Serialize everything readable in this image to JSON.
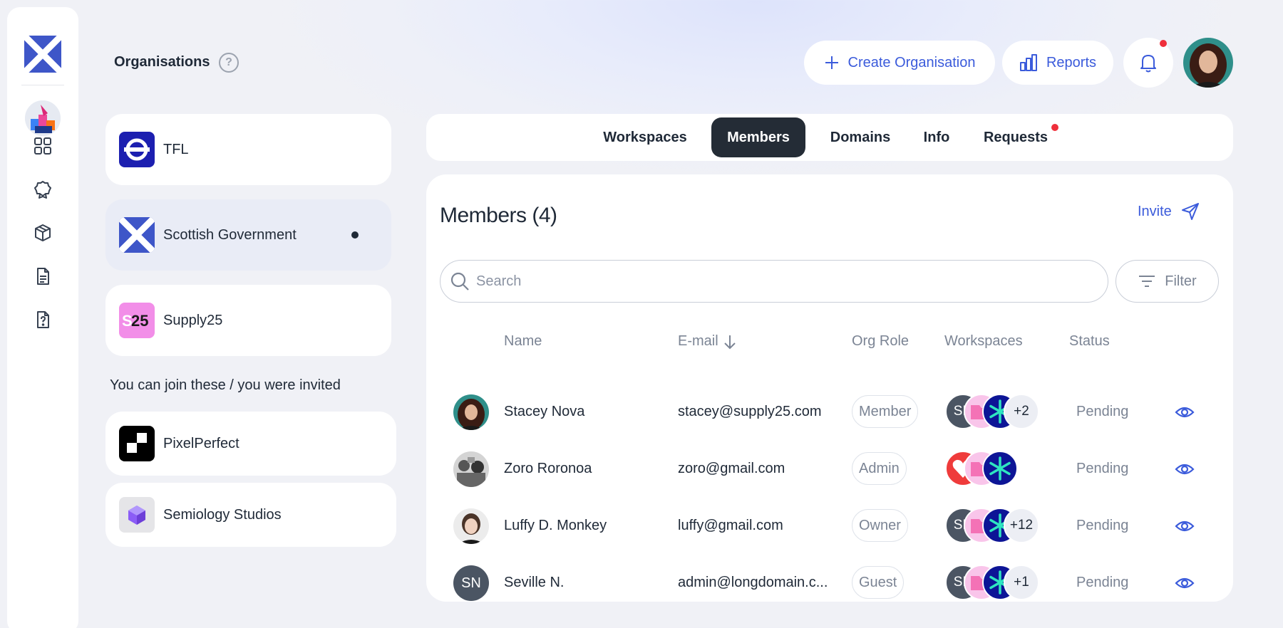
{
  "header": {
    "title": "Organisations",
    "create_label": "Create Organisation",
    "reports_label": "Reports"
  },
  "orgs": [
    {
      "name": "TFL"
    },
    {
      "name": "Scottish Government"
    },
    {
      "name": "Supply25"
    }
  ],
  "invited_label": "You can join these / you were invited",
  "invited_orgs": [
    {
      "name": "PixelPerfect"
    },
    {
      "name": "Semiology Studios"
    }
  ],
  "tabs": [
    {
      "label": "Workspaces"
    },
    {
      "label": "Members"
    },
    {
      "label": "Domains"
    },
    {
      "label": "Info"
    },
    {
      "label": "Requests"
    }
  ],
  "members": {
    "title": "Members (4)",
    "invite_label": "Invite",
    "search_placeholder": "Search",
    "filter_label": "Filter",
    "columns": {
      "name": "Name",
      "email": "E-mail",
      "role": "Org Role",
      "workspaces": "Workspaces",
      "status": "Status"
    },
    "rows": [
      {
        "name": "Stacey Nova",
        "email": "stacey@supply25.com",
        "role": "Member",
        "ws_first": "SN",
        "ws_more": "+2",
        "status": "Pending"
      },
      {
        "name": "Zoro Roronoa",
        "email": "zoro@gmail.com",
        "role": "Admin",
        "ws_first": "",
        "ws_more": "",
        "status": "Pending"
      },
      {
        "name": "Luffy D. Monkey",
        "email": "luffy@gmail.com",
        "role": "Owner",
        "ws_first": "SN",
        "ws_more": "+12",
        "status": "Pending"
      },
      {
        "name": "Seville N.",
        "initials": "SN",
        "email": "admin@longdomain.c...",
        "role": "Guest",
        "ws_first": "SN",
        "ws_more": "+1",
        "status": "Pending"
      }
    ]
  },
  "colors": {
    "accent": "#3b5bdb",
    "active_tab": "#242c36",
    "notification_dot": "#ef2f3b",
    "scotland_blue": "#3e56c8",
    "tfl_blue": "#1c1fb0",
    "supply25_pink": "#f28ee8"
  }
}
